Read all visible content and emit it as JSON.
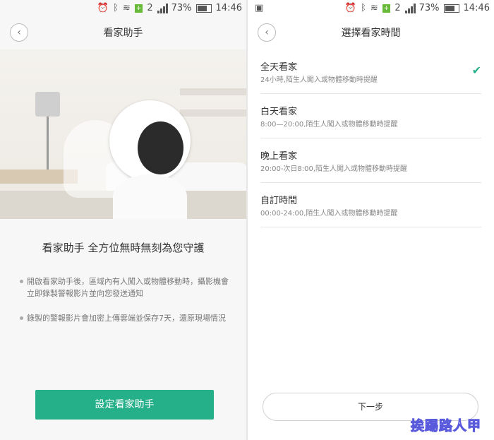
{
  "statusbar": {
    "battery": "73%",
    "time": "14:46",
    "network": "2",
    "wifi_tag": "+"
  },
  "left": {
    "nav": {
      "title": "看家助手",
      "back": "‹"
    },
    "headline": "看家助手 全方位無時無刻為您守護",
    "bullets": [
      "開啟看家助手後，區域內有人闖入或物體移動時，攝影機會立即錄製警報影片並向您發送通知",
      "錄製的警報影片會加密上傳雲端並保存7天，還原現場情況"
    ],
    "button": "設定看家助手"
  },
  "right": {
    "nav": {
      "title": "選擇看家時間",
      "back": "‹"
    },
    "options": [
      {
        "title": "全天看家",
        "desc": "24小時,陌生人闖入或物體移動時提醒",
        "checked": true
      },
      {
        "title": "白天看家",
        "desc": "8:00—20:00,陌生人闖入或物體移動時提醒",
        "checked": false
      },
      {
        "title": "晚上看家",
        "desc": "20:00-次日8:00,陌生人闖入或物體移動時提醒",
        "checked": false
      },
      {
        "title": "自訂時間",
        "desc": "00:00-24:00,陌生人闖入或物體移動時提醒",
        "checked": false
      }
    ],
    "check_mark": "✔",
    "next_button": "下一步"
  },
  "watermark": "挨踢路人甲",
  "colors": {
    "accent": "#26b08a"
  }
}
